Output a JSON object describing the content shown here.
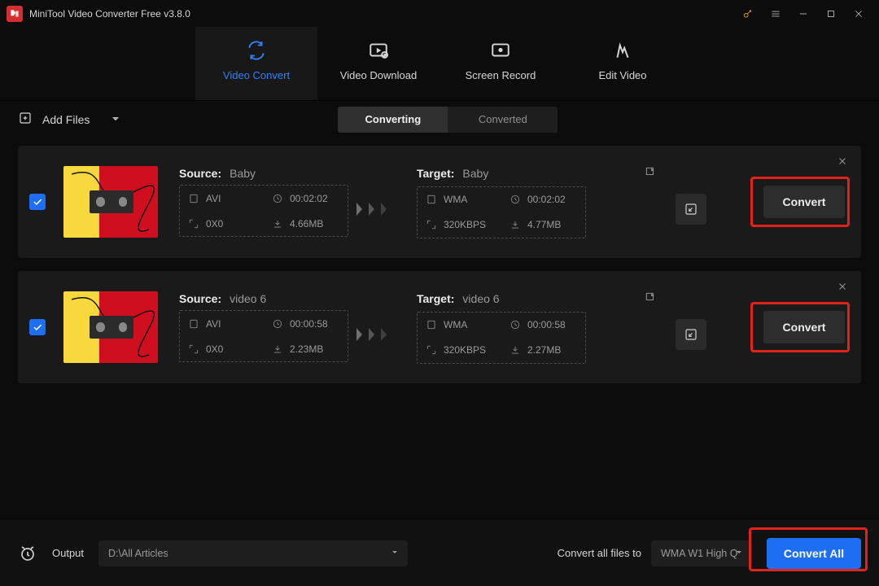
{
  "titlebar": {
    "app_title": "MiniTool Video Converter Free v3.8.0"
  },
  "tabs": {
    "video_convert": "Video Convert",
    "video_download": "Video Download",
    "screen_record": "Screen Record",
    "edit_video": "Edit Video"
  },
  "toolbar": {
    "add_files": "Add Files",
    "seg_converting": "Converting",
    "seg_converted": "Converted"
  },
  "labels": {
    "source": "Source:",
    "target": "Target:",
    "convert": "Convert"
  },
  "items": [
    {
      "source_name": "Baby",
      "target_name": "Baby",
      "src": {
        "fmt": "AVI",
        "dur": "00:02:02",
        "res": "0X0",
        "size": "4.66MB"
      },
      "tgt": {
        "fmt": "WMA",
        "dur": "00:02:02",
        "res": "320KBPS",
        "size": "4.77MB"
      }
    },
    {
      "source_name": "video 6",
      "target_name": "video 6",
      "src": {
        "fmt": "AVI",
        "dur": "00:00:58",
        "res": "0X0",
        "size": "2.23MB"
      },
      "tgt": {
        "fmt": "WMA",
        "dur": "00:00:58",
        "res": "320KBPS",
        "size": "2.27MB"
      }
    }
  ],
  "bottom": {
    "output_label": "Output",
    "output_path": "D:\\All Articles",
    "convert_all_to_label": "Convert all files to",
    "profile": "WMA W1 High Q",
    "convert_all": "Convert All"
  }
}
